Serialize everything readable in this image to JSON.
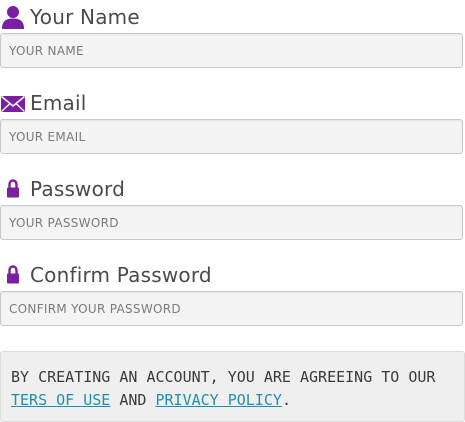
{
  "form": {
    "name": {
      "label": "Your Name",
      "placeholder": "YOUR NAME",
      "icon": "user-icon"
    },
    "email": {
      "label": "Email",
      "placeholder": "YOUR EMAIL",
      "icon": "envelope-icon"
    },
    "password": {
      "label": "Password",
      "placeholder": "YOUR PASSWORD",
      "icon": "lock-icon"
    },
    "confirm_password": {
      "label": "Confirm Password",
      "placeholder": "CONFIRM YOUR PASSWORD",
      "icon": "lock-icon"
    }
  },
  "agreement": {
    "text": "BY CREATING AN ACCOUNT, YOU ARE AGREEING TO OUR",
    "terms_link": "TERS OF USE",
    "and_text": "AND",
    "privacy_link": "PRIVACY POLICY",
    "period": "."
  },
  "colors": {
    "icon_purple": "#7a1fa2",
    "link_blue": "#1f8fb0"
  }
}
